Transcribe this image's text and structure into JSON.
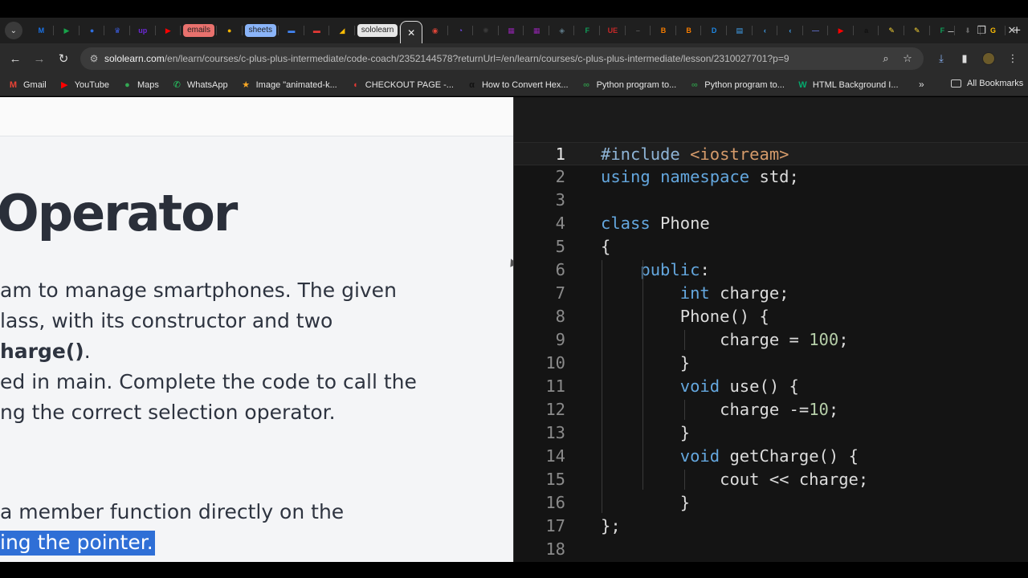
{
  "browser": {
    "tabs": [
      {
        "icon": "chevron-down-icon"
      },
      {
        "icon": "m-logo-icon",
        "text": "M",
        "color": "#1a73e8"
      },
      {
        "icon": "play-icon",
        "text": "▶",
        "color": "#17a34a"
      },
      {
        "icon": "circle-icon",
        "text": "●",
        "color": "#2f6fe0"
      },
      {
        "icon": "crown-icon",
        "text": "♛",
        "color": "#3b5bdb"
      },
      {
        "icon": "upwork-icon",
        "text": "up",
        "color": "#6d28d9"
      },
      {
        "icon": "youtube-icon",
        "text": "▶",
        "color": "#ff0000"
      },
      {
        "icon": "emails-tab",
        "pill": "emails",
        "pill_bg": "#e8716d",
        "pill_fg": "#1f1f1f"
      },
      {
        "icon": "pin-icon",
        "text": "●",
        "color": "#f4b400"
      },
      {
        "icon": "sheets-tab",
        "pill": "sheets",
        "pill_bg": "#8ab4f8",
        "pill_fg": "#1f1f1f"
      },
      {
        "icon": "docs-icon",
        "text": "▬",
        "color": "#4285f4"
      },
      {
        "icon": "slides-icon",
        "text": "▬",
        "color": "#e53935"
      },
      {
        "icon": "drive-icon",
        "text": "◢",
        "color": "#fbbc04"
      },
      {
        "icon": "sololearn-tab",
        "pill": "sololearn",
        "pill_bg": "#e6e6e6",
        "pill_fg": "#1f1f1f"
      },
      {
        "icon": "close-icon",
        "active": true,
        "text": "✕"
      },
      {
        "icon": "chrome-icon",
        "text": "◉",
        "color": "#db4437"
      },
      {
        "icon": "pie-icon",
        "text": "◔",
        "color": "#7c4dff"
      },
      {
        "icon": "chatgpt-icon",
        "text": "✺",
        "color": "#3a3a3a"
      },
      {
        "icon": "calendar-icon",
        "text": "▦",
        "color": "#8e24aa"
      },
      {
        "icon": "calendar-icon",
        "text": "▦",
        "color": "#8e24aa"
      },
      {
        "icon": "cube-icon",
        "text": "◈",
        "color": "#607d8b"
      },
      {
        "icon": "forms-icon",
        "text": "F",
        "color": "#0f9d58"
      },
      {
        "icon": "ue-icon",
        "text": "UE",
        "color": "#c62828"
      },
      {
        "icon": "dash-icon",
        "text": "–",
        "color": "#555"
      },
      {
        "icon": "blogger-icon",
        "text": "B",
        "color": "#f57c00"
      },
      {
        "icon": "blogger-icon",
        "text": "B",
        "color": "#f57c00"
      },
      {
        "icon": "d-icon",
        "text": "D",
        "color": "#1e88e5"
      },
      {
        "icon": "table-icon",
        "text": "▤",
        "color": "#42a5f5"
      },
      {
        "icon": "chevron-icon",
        "text": "‹",
        "color": "#42a5f5"
      },
      {
        "icon": "chevron-icon",
        "text": "‹",
        "color": "#42a5f5"
      },
      {
        "icon": "line-icon",
        "text": "—",
        "color": "#5c6bc0"
      },
      {
        "icon": "youtube-icon",
        "text": "▶",
        "color": "#ff0000"
      },
      {
        "icon": "amazon-icon",
        "text": "a",
        "color": "#111"
      },
      {
        "icon": "pen-icon",
        "text": "✎",
        "color": "#fdd835"
      },
      {
        "icon": "pen-icon",
        "text": "✎",
        "color": "#fdd835"
      },
      {
        "icon": "forms-icon",
        "text": "F",
        "color": "#0f9d58"
      },
      {
        "icon": "download-icon",
        "text": "⬇",
        "color": "#666"
      },
      {
        "icon": "g-icon",
        "text": "G",
        "color": "#fbbc04"
      }
    ],
    "url_host": "sololearn.com",
    "url_path": "/en/learn/courses/c-plus-plus-intermediate/code-coach/2352144578?returnUrl=/en/learn/courses/c-plus-plus-intermediate/lesson/2310027701?p=9",
    "bookmarks": [
      {
        "label": "Gmail",
        "icon": "gmail-icon",
        "color": "#ea4335",
        "glyph": "M"
      },
      {
        "label": "YouTube",
        "icon": "youtube-icon",
        "color": "#ff0000",
        "glyph": "▶"
      },
      {
        "label": "Maps",
        "icon": "maps-icon",
        "color": "#34a853",
        "glyph": "●"
      },
      {
        "label": "WhatsApp",
        "icon": "whatsapp-icon",
        "color": "#25d366",
        "glyph": "✆"
      },
      {
        "label": "Image \"animated-k...",
        "icon": "star-icon",
        "color": "#f9a825",
        "glyph": "★"
      },
      {
        "label": "CHECKOUT PAGE -...",
        "icon": "lips-icon",
        "color": "#e53935",
        "glyph": "◖"
      },
      {
        "label": "How to Convert Hex...",
        "icon": "alpha-icon",
        "color": "#111111",
        "glyph": "α"
      },
      {
        "label": "Python program to...",
        "icon": "gfg-icon",
        "color": "#2f8d46",
        "glyph": "∞"
      },
      {
        "label": "Python program to...",
        "icon": "gfg-icon",
        "color": "#2f8d46",
        "glyph": "∞"
      },
      {
        "label": "HTML Background I...",
        "icon": "w3-icon",
        "color": "#04aa6d",
        "glyph": "W"
      }
    ],
    "all_bookmarks": "All Bookmarks"
  },
  "lesson": {
    "title": "Operator",
    "lines": [
      {
        "text": "am to manage smartphones. The given"
      },
      {
        "text": "lass, with its constructor and two"
      },
      {
        "text": "",
        "bold": "harge()",
        "after": "."
      },
      {
        "text": "ed in main. Complete the code to call the"
      },
      {
        "text": "ng the correct selection operator."
      }
    ],
    "hint_line": "a member function directly on the",
    "highlight": "ing the pointer."
  },
  "editor": {
    "current_line": 1,
    "lines": [
      [
        {
          "t": "#include ",
          "c": "pp"
        },
        {
          "t": "<iostream>",
          "c": "inc"
        }
      ],
      [
        {
          "t": "using",
          "c": "kw"
        },
        {
          "t": " "
        },
        {
          "t": "namespace",
          "c": "kw"
        },
        {
          "t": " std;"
        }
      ],
      [],
      [
        {
          "t": "class",
          "c": "kw"
        },
        {
          "t": " Phone"
        }
      ],
      [
        {
          "t": "{"
        }
      ],
      [
        {
          "t": "    "
        },
        {
          "t": "public",
          "c": "kw"
        },
        {
          "t": ":"
        }
      ],
      [
        {
          "t": "        "
        },
        {
          "t": "int",
          "c": "kw"
        },
        {
          "t": " charge;"
        }
      ],
      [
        {
          "t": "        Phone() {"
        }
      ],
      [
        {
          "t": "            charge = "
        },
        {
          "t": "100",
          "c": "num"
        },
        {
          "t": ";"
        }
      ],
      [
        {
          "t": "        }"
        }
      ],
      [
        {
          "t": "        "
        },
        {
          "t": "void",
          "c": "kw"
        },
        {
          "t": " use() {"
        }
      ],
      [
        {
          "t": "            charge -="
        },
        {
          "t": "10",
          "c": "num"
        },
        {
          "t": ";"
        }
      ],
      [
        {
          "t": "        }"
        }
      ],
      [
        {
          "t": "        "
        },
        {
          "t": "void",
          "c": "kw"
        },
        {
          "t": " getCharge() {"
        }
      ],
      [
        {
          "t": "            cout << charge;"
        }
      ],
      [
        {
          "t": "        }"
        }
      ],
      [
        {
          "t": "};"
        }
      ],
      []
    ]
  }
}
